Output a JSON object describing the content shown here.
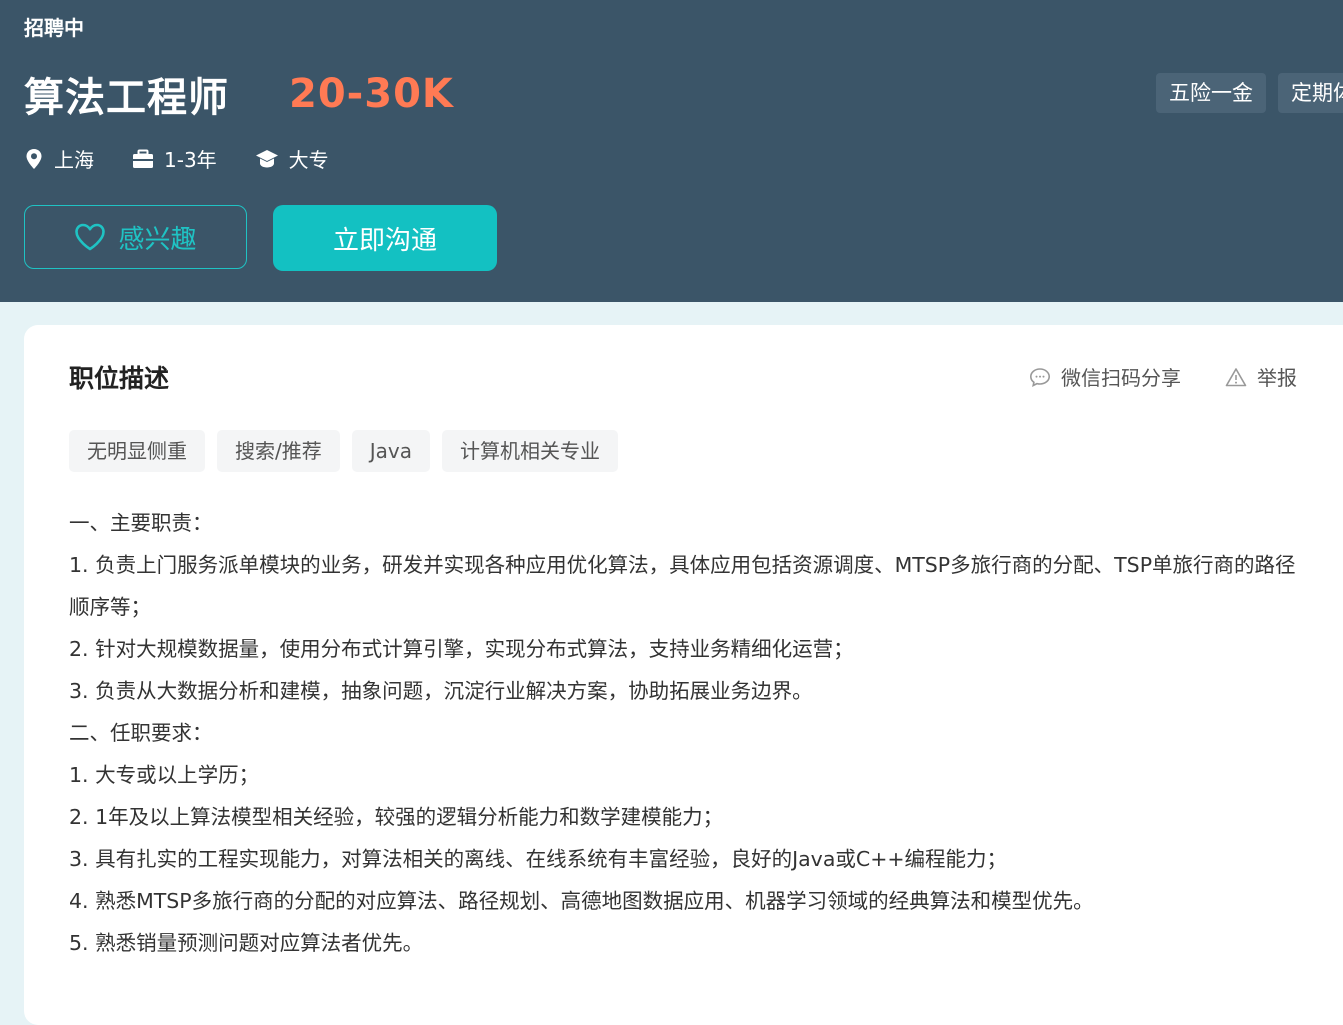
{
  "header": {
    "status": "招聘中",
    "job_title": "算法工程师",
    "salary": "20-30K",
    "benefits": [
      "五险一金",
      "定期体"
    ],
    "location": "上海",
    "experience": "1-3年",
    "education": "大专",
    "interest_label": "感兴趣",
    "chat_label": "立即沟通",
    "icons": {
      "location": "location-pin-icon",
      "experience": "briefcase-icon",
      "education": "graduation-cap-icon",
      "interest": "heart-icon"
    },
    "colors": {
      "background": "#3b5568",
      "salary": "#ff7a54",
      "accent": "#13c1c2"
    }
  },
  "card": {
    "title": "职位描述",
    "share_label": "微信扫码分享",
    "report_label": "举报",
    "tags": [
      "无明显侧重",
      "搜索/推荐",
      "Java",
      "计算机相关专业"
    ],
    "description": [
      "一、主要职责：",
      "1. 负责上门服务派单模块的业务，研发并实现各种应用优化算法，具体应用包括资源调度、MTSP多旅行商的分配、TSP单旅行商的路径顺序等；",
      "2. 针对大规模数据量，使用分布式计算引擎，实现分布式算法，支持业务精细化运营；",
      "3. 负责从大数据分析和建模，抽象问题，沉淀行业解决方案，协助拓展业务边界。",
      "二、任职要求：",
      "1. 大专或以上学历；",
      "2. 1年及以上算法模型相关经验，较强的逻辑分析能力和数学建模能力；",
      "3. 具有扎实的工程实现能力，对算法相关的离线、在线系统有丰富经验，良好的Java或C++编程能力；",
      "4. 熟悉MTSP多旅行商的分配的对应算法、路径规划、高德地图数据应用、机器学习领域的经典算法和模型优先。",
      "5. 熟悉销量预测问题对应算法者优先。"
    ],
    "icons": {
      "share": "chat-bubble-icon",
      "report": "warning-triangle-icon"
    }
  }
}
